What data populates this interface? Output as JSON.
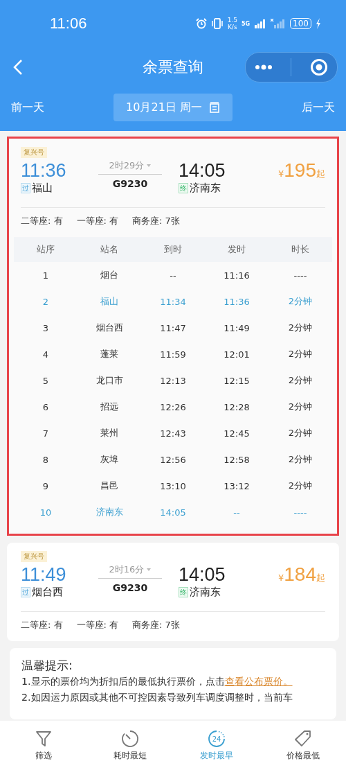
{
  "status_bar": {
    "time": "11:06",
    "speed_value": "1.5",
    "speed_unit": "K/s",
    "network": "5G",
    "battery": "100"
  },
  "nav": {
    "title": "余票查询"
  },
  "date_bar": {
    "prev": "前一天",
    "date": "10月21日 周一",
    "next": "后一天"
  },
  "trains": [
    {
      "highlighted": true,
      "brand": "复兴号",
      "depart_time": "11:36",
      "depart_mark": "过",
      "depart_station": "福山",
      "duration": "2时29分",
      "train_no": "G9230",
      "arrive_time": "14:05",
      "arrive_mark": "终",
      "arrive_station": "济南东",
      "currency": "¥",
      "price": "195",
      "price_suffix": "起",
      "seats": [
        "二等座: 有",
        "一等座: 有",
        "商务座: 7张"
      ],
      "stops": {
        "columns": [
          "站序",
          "站名",
          "到时",
          "发时",
          "时长"
        ],
        "rows": [
          {
            "selected": false,
            "cells": [
              "1",
              "烟台",
              "--",
              "11:16",
              "----"
            ]
          },
          {
            "selected": true,
            "cells": [
              "2",
              "福山",
              "11:34",
              "11:36",
              "2分钟"
            ]
          },
          {
            "selected": false,
            "cells": [
              "3",
              "烟台西",
              "11:47",
              "11:49",
              "2分钟"
            ]
          },
          {
            "selected": false,
            "cells": [
              "4",
              "蓬莱",
              "11:59",
              "12:01",
              "2分钟"
            ]
          },
          {
            "selected": false,
            "cells": [
              "5",
              "龙口市",
              "12:13",
              "12:15",
              "2分钟"
            ]
          },
          {
            "selected": false,
            "cells": [
              "6",
              "招远",
              "12:26",
              "12:28",
              "2分钟"
            ]
          },
          {
            "selected": false,
            "cells": [
              "7",
              "莱州",
              "12:43",
              "12:45",
              "2分钟"
            ]
          },
          {
            "selected": false,
            "cells": [
              "8",
              "灰埠",
              "12:56",
              "12:58",
              "2分钟"
            ]
          },
          {
            "selected": false,
            "cells": [
              "9",
              "昌邑",
              "13:10",
              "13:12",
              "2分钟"
            ]
          },
          {
            "selected": true,
            "cells": [
              "10",
              "济南东",
              "14:05",
              "--",
              "----"
            ]
          }
        ]
      }
    },
    {
      "highlighted": false,
      "brand": "复兴号",
      "depart_time": "11:49",
      "depart_mark": "过",
      "depart_station": "烟台西",
      "duration": "2时16分",
      "train_no": "G9230",
      "arrive_time": "14:05",
      "arrive_mark": "终",
      "arrive_station": "济南东",
      "currency": "¥",
      "price": "184",
      "price_suffix": "起",
      "seats": [
        "二等座: 有",
        "一等座: 有",
        "商务座: 7张"
      ]
    }
  ],
  "tips": {
    "title": "温馨提示:",
    "lines": [
      "1.显示的票价均为折扣后的最低执行票价，点击",
      "2.如因运力原因或其他不可控因素导致列车调度调整时，当前车"
    ],
    "link": "查看公布票价。"
  },
  "bottom_tabs": [
    {
      "label": "筛选",
      "kind": "filter",
      "selected": false
    },
    {
      "label": "耗时最短",
      "kind": "timer",
      "selected": false
    },
    {
      "label": "发时最早",
      "kind": "clock24",
      "selected": true,
      "icon_text": "24"
    },
    {
      "label": "价格最低",
      "kind": "tag",
      "selected": false
    }
  ]
}
